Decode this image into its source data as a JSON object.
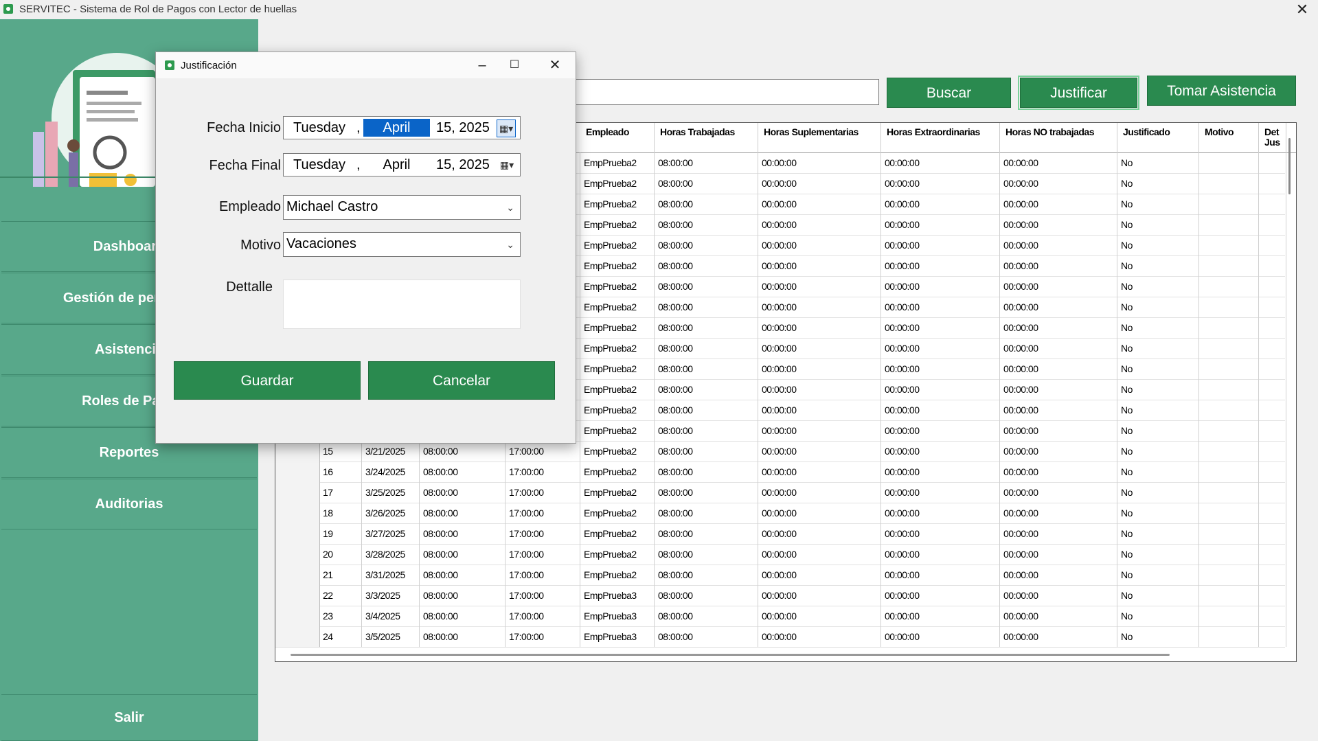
{
  "window": {
    "title": "SERVITEC - Sistema de Rol de Pagos con Lector de huellas"
  },
  "sidebar": {
    "items": [
      {
        "label": "Dashboard"
      },
      {
        "label": "Gestión de personal"
      },
      {
        "label": "Asistencia"
      },
      {
        "label": "Roles de Pago"
      },
      {
        "label": "Reportes"
      },
      {
        "label": "Auditorias"
      }
    ],
    "exit_label": "Salir"
  },
  "toolbar": {
    "search_value": "",
    "buscar": "Buscar",
    "justificar": "Justificar",
    "tomar_asistencia": "Tomar Asistencia"
  },
  "grid": {
    "headers": [
      "",
      "",
      "",
      "",
      "Empleado",
      "Horas Trabajadas",
      "Horas Suplementarias",
      "Horas Extraordinarias",
      "Horas NO trabajadas",
      "Justificado",
      "Motivo",
      "Det Jus"
    ],
    "rows": [
      [
        "",
        "",
        "",
        "",
        "EmpPrueba2",
        "08:00:00",
        "00:00:00",
        "00:00:00",
        "00:00:00",
        "No",
        "",
        ""
      ],
      [
        "",
        "",
        "",
        "",
        "EmpPrueba2",
        "08:00:00",
        "00:00:00",
        "00:00:00",
        "00:00:00",
        "No",
        "",
        ""
      ],
      [
        "",
        "",
        "",
        "",
        "EmpPrueba2",
        "08:00:00",
        "00:00:00",
        "00:00:00",
        "00:00:00",
        "No",
        "",
        ""
      ],
      [
        "",
        "",
        "",
        "",
        "EmpPrueba2",
        "08:00:00",
        "00:00:00",
        "00:00:00",
        "00:00:00",
        "No",
        "",
        ""
      ],
      [
        "",
        "",
        "",
        "",
        "EmpPrueba2",
        "08:00:00",
        "00:00:00",
        "00:00:00",
        "00:00:00",
        "No",
        "",
        ""
      ],
      [
        "",
        "",
        "",
        "",
        "EmpPrueba2",
        "08:00:00",
        "00:00:00",
        "00:00:00",
        "00:00:00",
        "No",
        "",
        ""
      ],
      [
        "",
        "",
        "",
        "",
        "EmpPrueba2",
        "08:00:00",
        "00:00:00",
        "00:00:00",
        "00:00:00",
        "No",
        "",
        ""
      ],
      [
        "",
        "",
        "",
        "",
        "EmpPrueba2",
        "08:00:00",
        "00:00:00",
        "00:00:00",
        "00:00:00",
        "No",
        "",
        ""
      ],
      [
        "",
        "",
        "",
        "",
        "EmpPrueba2",
        "08:00:00",
        "00:00:00",
        "00:00:00",
        "00:00:00",
        "No",
        "",
        ""
      ],
      [
        "",
        "",
        "",
        "",
        "EmpPrueba2",
        "08:00:00",
        "00:00:00",
        "00:00:00",
        "00:00:00",
        "No",
        "",
        ""
      ],
      [
        "",
        "",
        "",
        "",
        "EmpPrueba2",
        "08:00:00",
        "00:00:00",
        "00:00:00",
        "00:00:00",
        "No",
        "",
        ""
      ],
      [
        "",
        "",
        "",
        "",
        "EmpPrueba2",
        "08:00:00",
        "00:00:00",
        "00:00:00",
        "00:00:00",
        "No",
        "",
        ""
      ],
      [
        "",
        "",
        "",
        "",
        "EmpPrueba2",
        "08:00:00",
        "00:00:00",
        "00:00:00",
        "00:00:00",
        "No",
        "",
        ""
      ],
      [
        "",
        "",
        "",
        "",
        "EmpPrueba2",
        "08:00:00",
        "00:00:00",
        "00:00:00",
        "00:00:00",
        "No",
        "",
        ""
      ],
      [
        "",
        "15",
        "3/21/2025",
        "08:00:00",
        "EmpPrueba2",
        "08:00:00",
        "00:00:00",
        "00:00:00",
        "00:00:00",
        "No",
        "",
        ""
      ],
      [
        "",
        "16",
        "3/24/2025",
        "08:00:00",
        "EmpPrueba2",
        "08:00:00",
        "00:00:00",
        "00:00:00",
        "00:00:00",
        "No",
        "",
        ""
      ],
      [
        "",
        "17",
        "3/25/2025",
        "08:00:00",
        "EmpPrueba2",
        "08:00:00",
        "00:00:00",
        "00:00:00",
        "00:00:00",
        "No",
        "",
        ""
      ],
      [
        "",
        "18",
        "3/26/2025",
        "08:00:00",
        "EmpPrueba2",
        "08:00:00",
        "00:00:00",
        "00:00:00",
        "00:00:00",
        "No",
        "",
        ""
      ],
      [
        "",
        "19",
        "3/27/2025",
        "08:00:00",
        "EmpPrueba2",
        "08:00:00",
        "00:00:00",
        "00:00:00",
        "00:00:00",
        "No",
        "",
        ""
      ],
      [
        "",
        "20",
        "3/28/2025",
        "08:00:00",
        "EmpPrueba2",
        "08:00:00",
        "00:00:00",
        "00:00:00",
        "00:00:00",
        "No",
        "",
        ""
      ],
      [
        "",
        "21",
        "3/31/2025",
        "08:00:00",
        "EmpPrueba2",
        "08:00:00",
        "00:00:00",
        "00:00:00",
        "00:00:00",
        "No",
        "",
        ""
      ],
      [
        "",
        "22",
        "3/3/2025",
        "08:00:00",
        "EmpPrueba3",
        "08:00:00",
        "00:00:00",
        "00:00:00",
        "00:00:00",
        "No",
        "",
        ""
      ],
      [
        "",
        "23",
        "3/4/2025",
        "08:00:00",
        "EmpPrueba3",
        "08:00:00",
        "00:00:00",
        "00:00:00",
        "00:00:00",
        "No",
        "",
        ""
      ],
      [
        "",
        "24",
        "3/5/2025",
        "08:00:00",
        "EmpPrueba3",
        "08:00:00",
        "00:00:00",
        "00:00:00",
        "00:00:00",
        "No",
        "",
        ""
      ]
    ],
    "salida": "17:00:00"
  },
  "dialog": {
    "title": "Justificación",
    "fecha_inicio_label": "Fecha Inicio",
    "fecha_final_label": "Fecha Final",
    "empleado_label": "Empleado",
    "motivo_label": "Motivo",
    "detalle_label": "Dettalle",
    "fecha_inicio": {
      "weekday": "Tuesday",
      "sep": ",",
      "month": "April",
      "daydate": "15, 2025"
    },
    "fecha_final": {
      "weekday": "Tuesday",
      "sep": ",",
      "month": "April",
      "daydate": "15, 2025"
    },
    "empleado_value": "Michael Castro",
    "motivo_value": "Vacaciones",
    "detalle_value": "",
    "guardar": "Guardar",
    "cancelar": "Cancelar"
  },
  "colors": {
    "sidebar": "#58a88a",
    "button": "#2a8a4f",
    "selection": "#0a64c8"
  },
  "icons": [
    "app-icon",
    "close-icon",
    "minimize-icon",
    "maximize-icon",
    "calendar-icon",
    "chevron-down-icon"
  ]
}
